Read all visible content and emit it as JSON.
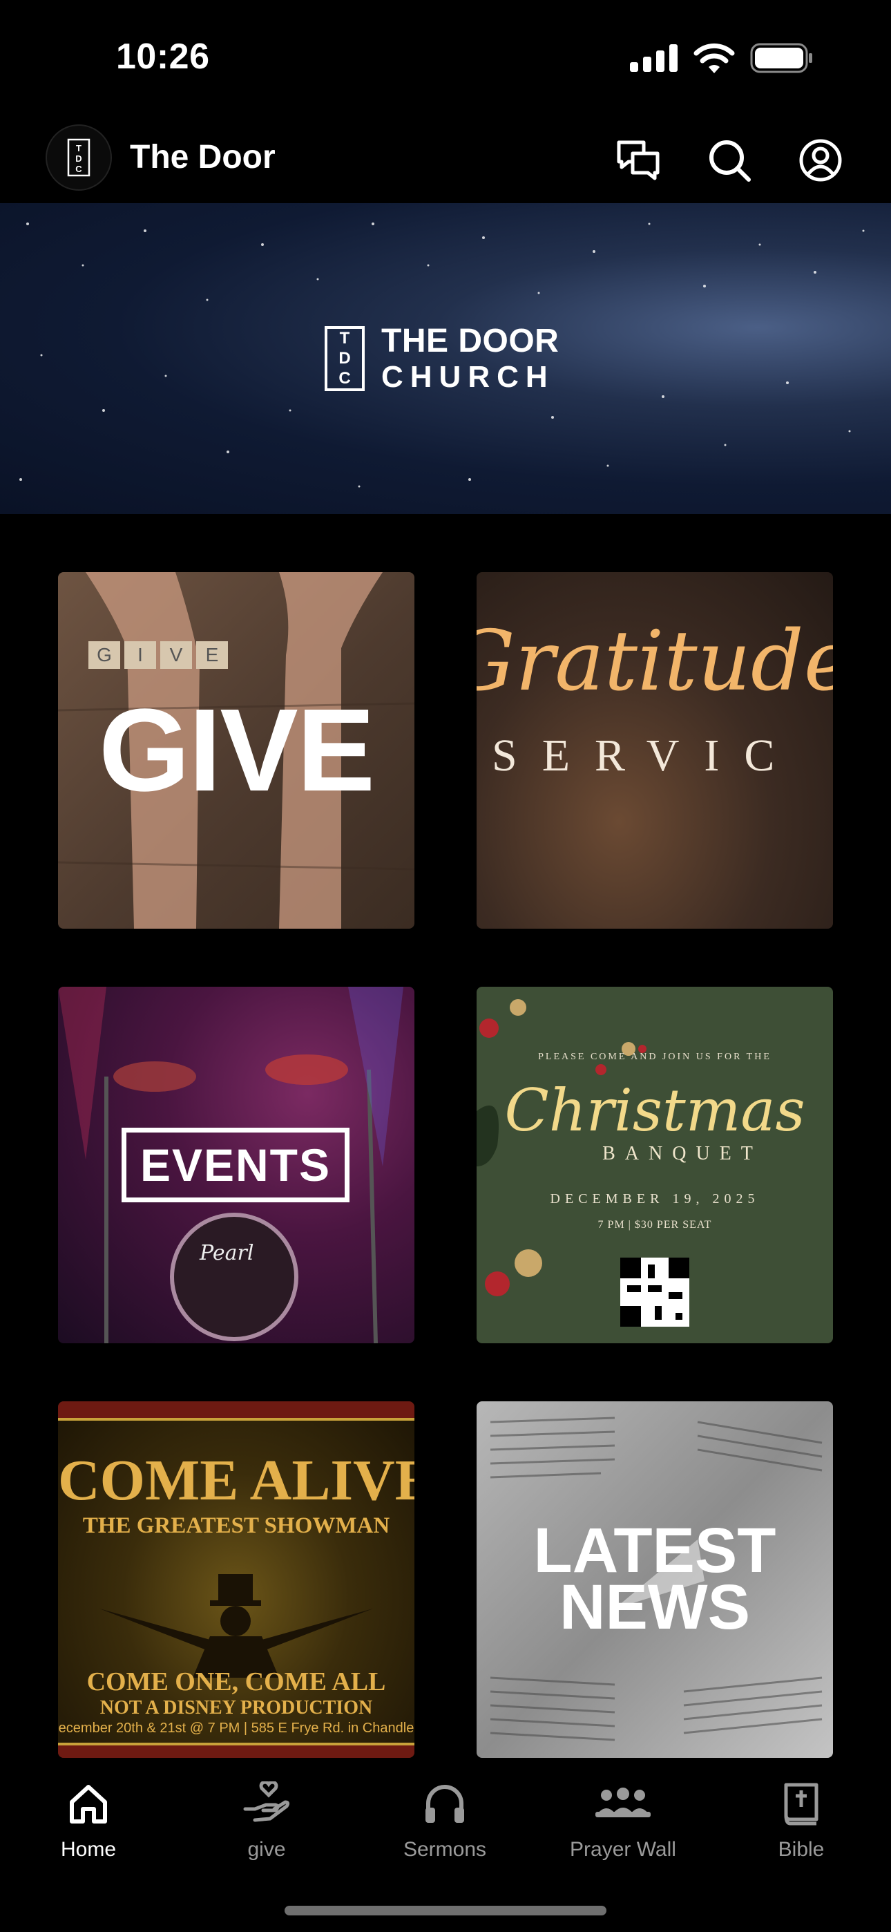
{
  "status_bar": {
    "time": "10:26"
  },
  "top_bar": {
    "logo_mark": "TDC",
    "title": "The Door"
  },
  "hero": {
    "mark_letters": [
      "T",
      "D",
      "C"
    ],
    "line1": "THE DOOR",
    "line2": "CHURCH"
  },
  "tiles": {
    "give": {
      "main_text": "GIVE",
      "tiles_text": [
        "G",
        "I",
        "V",
        "E"
      ]
    },
    "gratitude": {
      "script_text": "Gratitude",
      "sub_text": "SERVIC"
    },
    "events": {
      "label": "EVENTS",
      "drum_brand": "Pearl"
    },
    "christmas": {
      "invite": "PLEASE COME AND JOIN US FOR THE",
      "title": "Christmas",
      "subtitle": "BANQUET",
      "date": "DECEMBER 19, 2025",
      "details": "7 PM | $30 PER SEAT"
    },
    "come_alive": {
      "title": "COME ALIVE",
      "subtitle": "THE GREATEST SHOWMAN",
      "tagline": "COME ONE, COME ALL",
      "note": "NOT A DISNEY PRODUCTION",
      "details": "ecember 20th & 21st @ 7 PM | 585 E Frye Rd. in Chandle"
    },
    "news": {
      "line1": "LATEST",
      "line2": "NEWS"
    }
  },
  "bottom_nav": {
    "items": [
      {
        "label": "Home",
        "icon": "home-icon",
        "active": true
      },
      {
        "label": "give",
        "icon": "hand-heart-icon",
        "active": false
      },
      {
        "label": "Sermons",
        "icon": "headphones-icon",
        "active": false
      },
      {
        "label": "Prayer Wall",
        "icon": "people-group-icon",
        "active": false
      },
      {
        "label": "Bible",
        "icon": "bible-icon",
        "active": false
      }
    ]
  },
  "colors": {
    "background": "#000000",
    "active": "#ffffff",
    "inactive": "#9a9a9a",
    "gold": "#e3b04b"
  }
}
